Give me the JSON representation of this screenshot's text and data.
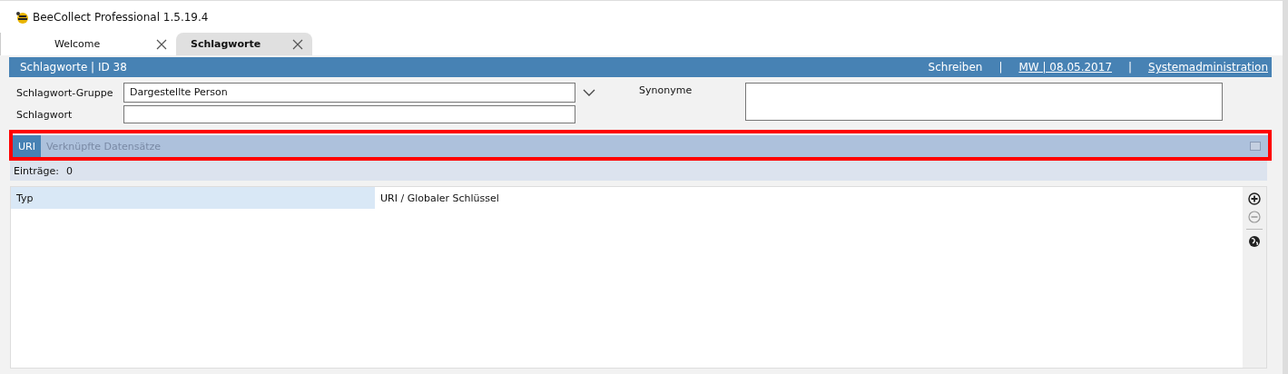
{
  "window": {
    "title": "BeeCollect Professional 1.5.19.4"
  },
  "tabs": [
    {
      "label": "Welcome",
      "selected": false
    },
    {
      "label": "Schlagworte",
      "selected": true
    }
  ],
  "header": {
    "title": "Schlagworte | ID 38",
    "links": [
      {
        "label": "Schreiben",
        "kind": "plain"
      },
      {
        "label": "|",
        "kind": "separator"
      },
      {
        "label": "MW | 08.05.2017",
        "kind": "link"
      },
      {
        "label": "|",
        "kind": "separator"
      },
      {
        "label": "Systemadministration",
        "kind": "link"
      }
    ]
  },
  "form": {
    "group_label": "Schlagwort-Gruppe",
    "group_value": "Dargestellte Person",
    "keyword_label": "Schlagwort",
    "synonyms_label": "Synonyme"
  },
  "subtabs": [
    {
      "label": "URI",
      "selected": true
    },
    {
      "label": "Verknüpfte Datensätze",
      "selected": false
    }
  ],
  "entries": {
    "label": "Einträge:",
    "count": "0"
  },
  "table": {
    "columns": [
      "Typ",
      "URI / Globaler Schlüssel"
    ]
  }
}
